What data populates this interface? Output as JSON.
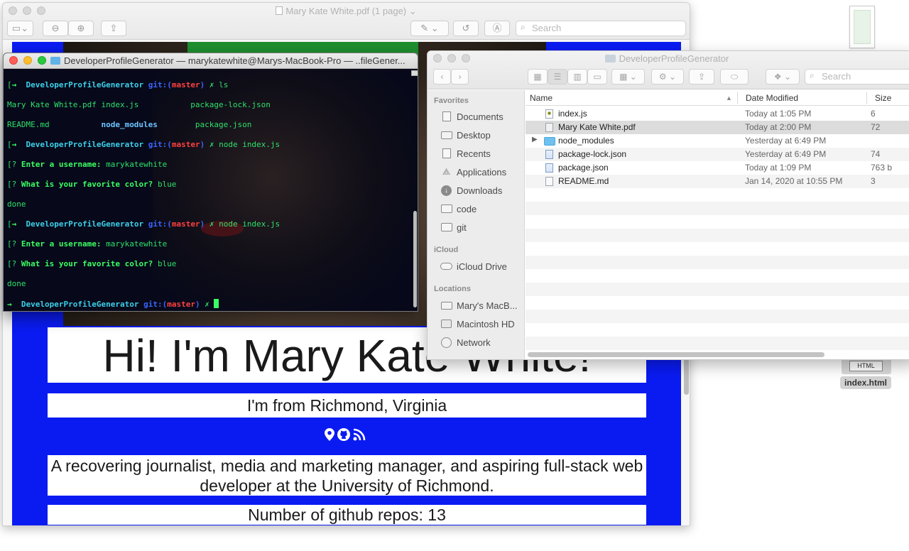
{
  "desktop": {
    "file_label": "index.html",
    "file_tag": "HTML"
  },
  "preview": {
    "title": "Mary Kate White.pdf (1 page)",
    "search_placeholder": "Search",
    "pdf": {
      "greeting": "Hi! I'm Mary Kate White!",
      "location": "I'm from Richmond, Virginia",
      "bio": "A recovering journalist, media and marketing manager, and aspiring full-stack web developer at the University of Richmond.",
      "repos": "Number of github repos: 13"
    }
  },
  "terminal": {
    "title": "DeveloperProfileGenerator — marykatewhite@Marys-MacBook-Pro — ..fileGener...",
    "prompt_dir": "DeveloperProfileGenerator",
    "git_label": "git:(",
    "branch": "master",
    "git_close": ")",
    "dirty_mark": "✗",
    "cmd_ls": "ls",
    "ls_out_1": "Mary Kate White.pdf index.js           package-lock.json",
    "ls_out_2a": "README.md           ",
    "ls_out_2b": "node_modules",
    "ls_out_2c": "        package.json",
    "cmd_node": "node index.js",
    "q_username": "Enter a username:",
    "a_username": "marykatewhite",
    "q_color": "What is your favorite color?",
    "a_color": "blue",
    "done": "done"
  },
  "finder": {
    "title": "DeveloperProfileGenerator",
    "search_placeholder": "Search",
    "sidebar": {
      "favorites_header": "Favorites",
      "favorites": [
        "Documents",
        "Desktop",
        "Recents",
        "Applications",
        "Downloads",
        "code",
        "git"
      ],
      "icloud_header": "iCloud",
      "icloud_drive": "iCloud Drive",
      "locations_header": "Locations",
      "locations": [
        "Mary's MacB...",
        "Macintosh HD",
        "Network"
      ]
    },
    "columns": {
      "name": "Name",
      "date": "Date Modified",
      "size": "Size"
    },
    "files": [
      {
        "name": "index.js",
        "date": "Today at 1:05 PM",
        "size": "6"
      },
      {
        "name": "Mary Kate White.pdf",
        "date": "Today at 2:00 PM",
        "size": "72"
      },
      {
        "name": "node_modules",
        "date": "Yesterday at 6:49 PM",
        "size": ""
      },
      {
        "name": "package-lock.json",
        "date": "Yesterday at 6:49 PM",
        "size": "74"
      },
      {
        "name": "package.json",
        "date": "Today at 1:09 PM",
        "size": "763 b"
      },
      {
        "name": "README.md",
        "date": "Jan 14, 2020 at 10:55 PM",
        "size": "3"
      }
    ]
  }
}
